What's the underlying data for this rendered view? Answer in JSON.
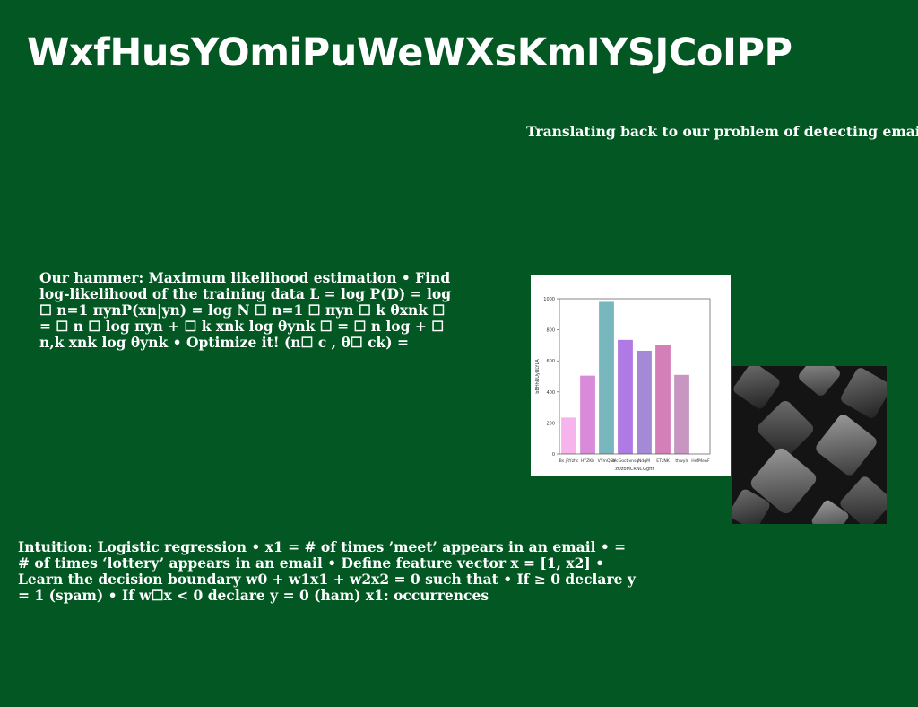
{
  "page": {
    "title": "WxfHusYOmiPuWeWXsKmIYSJCoIPP",
    "paragraphs": {
      "top": "Translating back to our problem of detecting emails • Collect a lot of ham and spam emails as",
      "middle": "Our hammer: Maximum likelihood estimation • Find log-likelihood of the training data L = log P(D) = log ☐ n=1 πynP(xn|yn) = log N ☐ n=1 ☐ πyn ☐ k θxnk ☐ = ☐ n ☐ log πyn + ☐ k xnk log θynk ☐ = ☐ n log + ☐ n,k xnk log θynk • Optimize it! (n☐ c , θ☐ ck) =",
      "bottom": "Intuition: Logistic regression • x1 = # of times ’meet’ appears in an email • = # of times ‘lottery’ appears in an email • Define feature vector x = [1, x2] • Learn the decision boundary w0 + w1x1 + w2x2 = 0 such that • If ≥ 0 declare y = 1 (spam) • If w☐x < 0 declare y = 0 (ham) x1: occurrences"
    },
    "photo_icon": "abstract-dark-cubes-image"
  },
  "chart_data": {
    "type": "bar",
    "categories": [
      "Bs jRYzhc",
      "HYZKh",
      "VYmQSa",
      "WcGocbvnsq",
      "NdgM",
      "ETzNK",
      "thwylr",
      "HefMeAF"
    ],
    "values": [
      235,
      505,
      980,
      735,
      665,
      700,
      510,
      0
    ],
    "colors": [
      "#f7b4ec",
      "#d98ad9",
      "#79b7bf",
      "#b07ae4",
      "#a48ad6",
      "#d57fb8",
      "#c797c2",
      "#c797c2"
    ],
    "xlabel": "zOzoMCRNCGgftt",
    "ylabel": "bBHhRUyBLYLA",
    "ylim": [
      0,
      1000
    ],
    "yticks": [
      0,
      200,
      400,
      600,
      800,
      1000
    ]
  }
}
